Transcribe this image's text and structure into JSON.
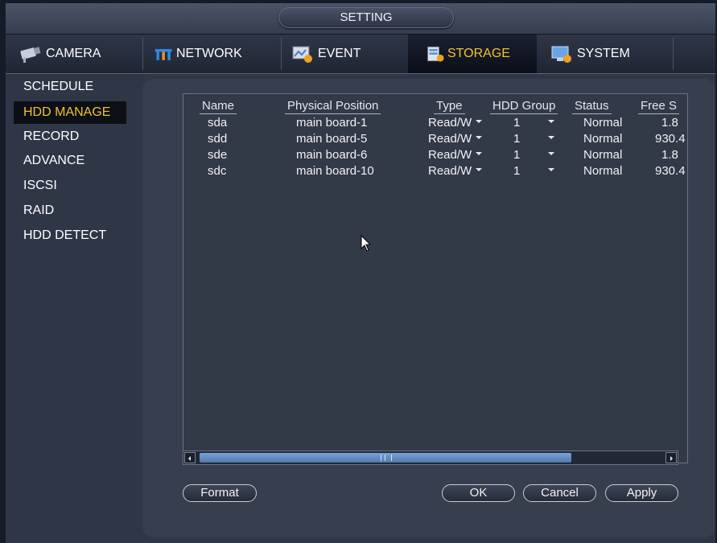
{
  "window": {
    "title": "SETTING"
  },
  "tabs": [
    {
      "label": "CAMERA",
      "icon": "camera-icon",
      "active": false
    },
    {
      "label": "NETWORK",
      "icon": "network-icon",
      "active": false
    },
    {
      "label": "EVENT",
      "icon": "event-icon",
      "active": false
    },
    {
      "label": "STORAGE",
      "icon": "storage-icon",
      "active": true
    },
    {
      "label": "SYSTEM",
      "icon": "system-icon",
      "active": false
    }
  ],
  "sidebar": {
    "items": [
      {
        "label": "SCHEDULE",
        "active": false
      },
      {
        "label": "HDD MANAGE",
        "active": true
      },
      {
        "label": "RECORD",
        "active": false
      },
      {
        "label": "ADVANCE",
        "active": false
      },
      {
        "label": "ISCSI",
        "active": false
      },
      {
        "label": "RAID",
        "active": false
      },
      {
        "label": "HDD DETECT",
        "active": false
      }
    ]
  },
  "table": {
    "headers": [
      "Name",
      "Physical Position",
      "Type",
      "HDD Group",
      "Status",
      "Free S"
    ],
    "rows": [
      {
        "name": "sda",
        "position": "main board-1",
        "type": "Read/W",
        "group": "1",
        "status": "Normal",
        "free": "1.8"
      },
      {
        "name": "sdd",
        "position": "main board-5",
        "type": "Read/W",
        "group": "1",
        "status": "Normal",
        "free": "930.4"
      },
      {
        "name": "sde",
        "position": "main board-6",
        "type": "Read/W",
        "group": "1",
        "status": "Normal",
        "free": "1.8"
      },
      {
        "name": "sdc",
        "position": "main board-10",
        "type": "Read/W",
        "group": "1",
        "status": "Normal",
        "free": "930.4"
      }
    ]
  },
  "buttons": {
    "format": "Format",
    "ok": "OK",
    "cancel": "Cancel",
    "apply": "Apply"
  },
  "colors": {
    "accent": "#f2c230",
    "background": "#2f3646",
    "panel": "#373e4d",
    "scroll_thumb": "#6a93c8"
  }
}
